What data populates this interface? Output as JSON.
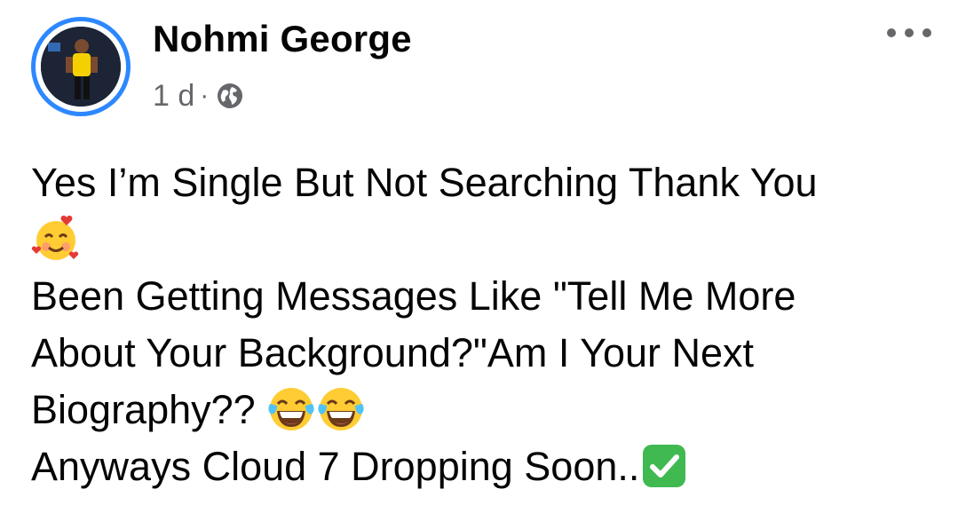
{
  "post": {
    "author": {
      "name": "Nohmi George",
      "avatar_icon": "profile-photo"
    },
    "meta": {
      "time": "1 d",
      "separator": "·",
      "privacy_icon": "globe-icon"
    },
    "more_icon": "more-options-icon",
    "lines": [
      {
        "text": "Yes I’m Single But Not Searching Thank You",
        "emoji": []
      },
      {
        "text": "",
        "emoji": [
          "smiling-face-with-hearts"
        ]
      },
      {
        "text": "Been Getting Messages Like \"Tell Me More",
        "emoji": []
      },
      {
        "text": "About Your Background?\"Am I Your Next",
        "emoji": []
      },
      {
        "text": "Biography?? ",
        "emoji": [
          "face-with-tears-of-joy",
          "face-with-tears-of-joy"
        ]
      },
      {
        "text": "Anyways Cloud 7 Dropping Soon..",
        "emoji": [
          "check-mark-button"
        ]
      }
    ]
  },
  "colors": {
    "accent": "#2d88ff",
    "secondary_text": "#65676b",
    "check_green": "#3fb950"
  }
}
